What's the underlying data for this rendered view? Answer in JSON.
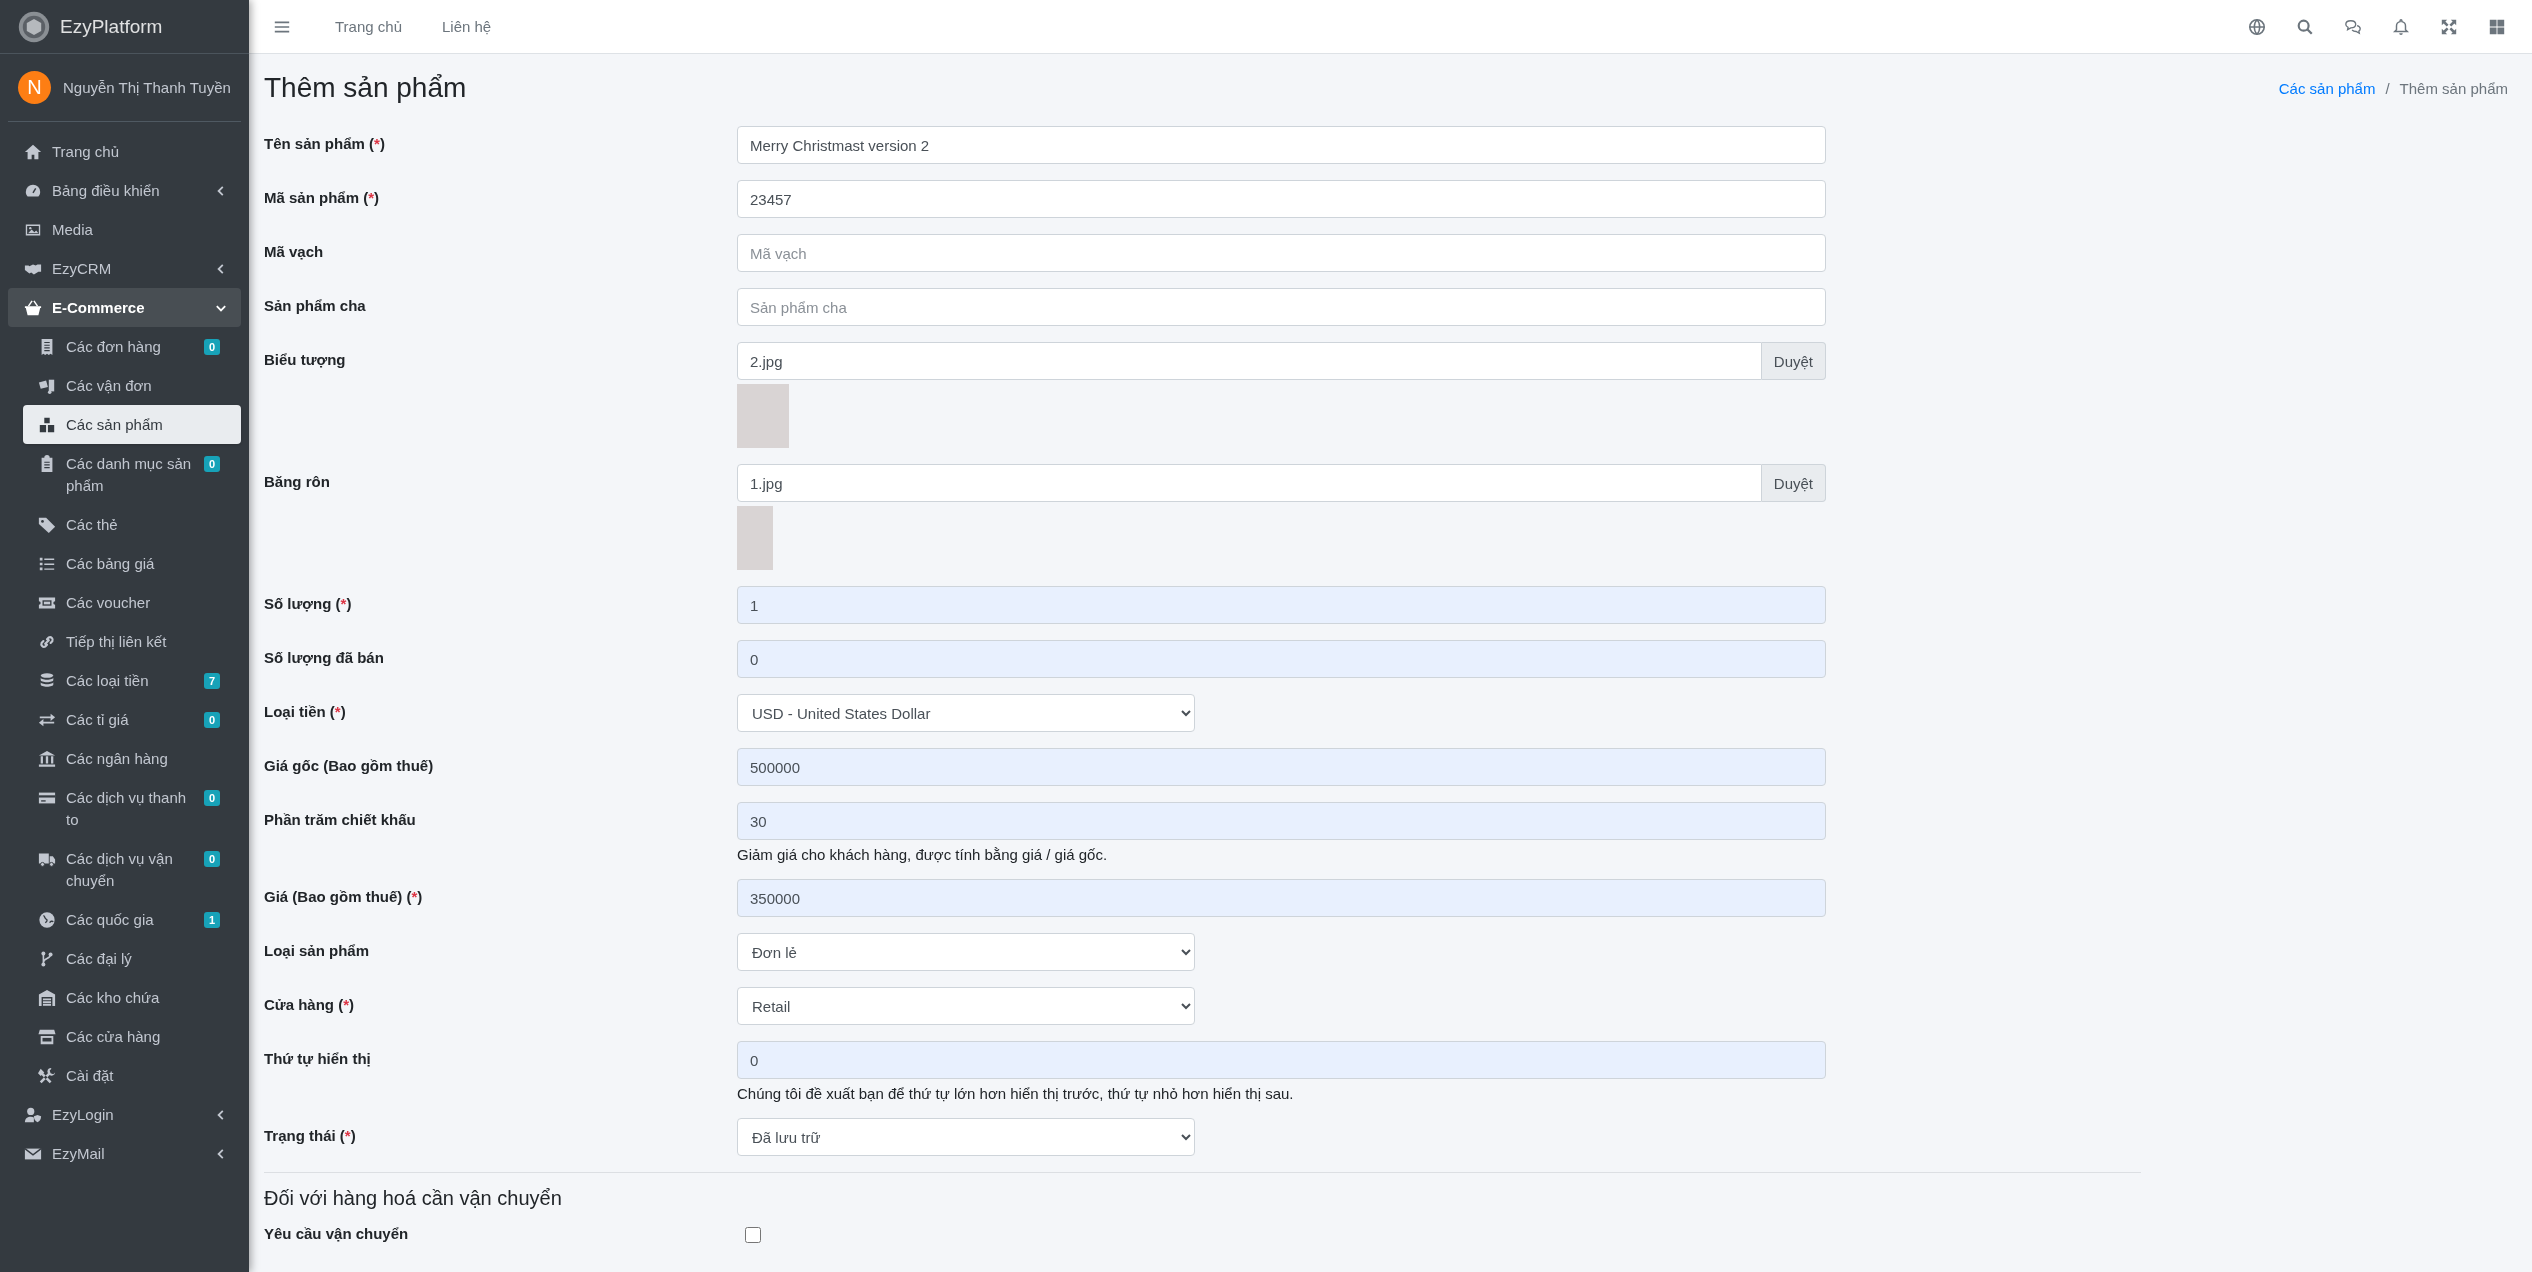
{
  "sidebar": {
    "brand": "EzyPlatform",
    "user": {
      "initial": "N",
      "name": "Nguyễn Thị Thanh Tuyền"
    },
    "items": [
      {
        "label": "Trang chủ",
        "selected": false
      },
      {
        "label": "Bảng điều khiển",
        "selected": false,
        "expanded": false
      },
      {
        "label": "Media",
        "selected": false
      },
      {
        "label": "EzyCRM",
        "selected": false,
        "expanded": false
      },
      {
        "label": "E-Commerce",
        "selected": true,
        "expanded": true,
        "children": [
          {
            "label": "Các đơn hàng",
            "selected": false,
            "badge": "0"
          },
          {
            "label": "Các vận đơn",
            "selected": false
          },
          {
            "label": "Các sản phẩm",
            "selected": true
          },
          {
            "label": "Các danh mục sản phẩm",
            "selected": false,
            "badge": "0"
          },
          {
            "label": "Các thẻ",
            "selected": false
          },
          {
            "label": "Các bảng giá",
            "selected": false
          },
          {
            "label": "Các voucher",
            "selected": false
          },
          {
            "label": "Tiếp thị liên kết",
            "selected": false
          },
          {
            "label": "Các loại tiền",
            "selected": false,
            "badge": "7"
          },
          {
            "label": "Các tỉ giá",
            "selected": false,
            "badge": "0"
          },
          {
            "label": "Các ngân hàng",
            "selected": false
          },
          {
            "label": "Các dịch vụ thanh to",
            "selected": false,
            "badge": "0"
          },
          {
            "label": "Các dịch vụ vận chuyển",
            "selected": false,
            "badge": "0"
          },
          {
            "label": "Các quốc gia",
            "selected": false,
            "badge": "1"
          },
          {
            "label": "Các đại lý",
            "selected": false
          },
          {
            "label": "Các kho chứa",
            "selected": false
          },
          {
            "label": "Các cửa hàng",
            "selected": false
          },
          {
            "label": "Cài đặt",
            "selected": false
          }
        ]
      },
      {
        "label": "EzyLogin",
        "selected": false,
        "expanded": false
      },
      {
        "label": "EzyMail",
        "selected": false,
        "expanded": false
      }
    ]
  },
  "topbar": {
    "links": [
      "Trang chủ",
      "Liên hệ"
    ]
  },
  "page": {
    "title": "Thêm sản phẩm",
    "breadcrumb_separator": "/",
    "breadcrumb": [
      {
        "label": "Các sản phẩm",
        "kind": "link"
      },
      {
        "label": "Thêm sản phẩm",
        "kind": "current"
      }
    ]
  },
  "form": {
    "fields": [
      {
        "kind": "text",
        "label": "Tên sản phẩm",
        "required_mark": "(*)",
        "value": "Merry Christmast version 2",
        "autofilled": false
      },
      {
        "kind": "text",
        "label": "Mã sản phẩm",
        "required_mark": "(*)",
        "value": "23457",
        "autofilled": false
      },
      {
        "kind": "text",
        "label": "Mã vạch",
        "placeholder": "Mã vạch",
        "autofilled": false
      },
      {
        "kind": "text",
        "label": "Sản phẩm cha",
        "placeholder": "Sản phẩm cha",
        "autofilled": false
      },
      {
        "kind": "file",
        "label": "Biểu tượng",
        "value": "2.jpg",
        "button": "Duyệt"
      },
      {
        "kind": "file",
        "label": "Băng rôn",
        "value": "1.jpg",
        "button": "Duyệt"
      },
      {
        "kind": "text",
        "label": "Số lượng",
        "required_mark": "(*)",
        "value": "1",
        "autofilled": true
      },
      {
        "kind": "text",
        "label": "Số lượng đã bán",
        "value": "0",
        "autofilled": true
      },
      {
        "kind": "select",
        "label": "Loại tiền",
        "required_mark": "(*)",
        "value": "USD - United States Dollar"
      },
      {
        "kind": "text",
        "label": "Giá gốc (Bao gồm thuế)",
        "value": "500000",
        "autofilled": true
      },
      {
        "kind": "text",
        "label": "Phần trăm chiết khấu",
        "value": "30",
        "autofilled": true,
        "help": "Giảm giá cho khách hàng, được tính bằng giá / giá gốc."
      },
      {
        "kind": "text",
        "label": "Giá (Bao gồm thuế)",
        "required_mark": "(*)",
        "value": "350000",
        "autofilled": true
      },
      {
        "kind": "select",
        "label": "Loại sản phẩm",
        "value": "Đơn lẻ"
      },
      {
        "kind": "select",
        "label": "Cửa hàng",
        "required_mark": "(*)",
        "value": "Retail"
      },
      {
        "kind": "text",
        "label": "Thứ tự hiển thị",
        "value": "0",
        "autofilled": true,
        "help": "Chúng tôi đề xuất bạn để thứ tự lớn hơn hiển thị trước, thứ tự nhỏ hơn hiển thị sau."
      },
      {
        "kind": "select",
        "label": "Trạng thái",
        "required_mark": "(*)",
        "value": "Đã lưu trữ"
      }
    ],
    "section": {
      "heading": "Đối với hàng hoá cần vận chuyển",
      "fields": [
        {
          "kind": "checkbox",
          "label": "Yêu cầu vận chuyển",
          "checked": false
        }
      ]
    }
  }
}
